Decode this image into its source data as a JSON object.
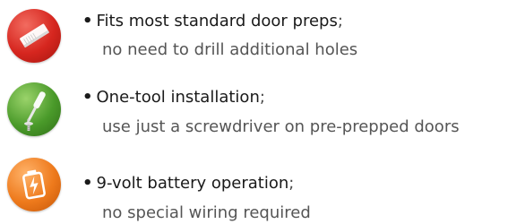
{
  "colors": {
    "red_icon": "#d6261f",
    "green_icon": "#4a9a2a",
    "orange_icon": "#ee7a1c"
  },
  "features": [
    {
      "icon": "door-prep-icon",
      "bullet": "•",
      "title": "Fits most standard door preps",
      "separator": ";",
      "detail": "no need to drill additional holes"
    },
    {
      "icon": "screwdriver-icon",
      "bullet": "•",
      "title": "One-tool installation",
      "separator": ";",
      "detail": "use just a screwdriver on pre-prepped doors"
    },
    {
      "icon": "battery-icon",
      "bullet": "•",
      "title": "9-volt battery operation",
      "separator": ";",
      "detail": "no special wiring required"
    }
  ]
}
